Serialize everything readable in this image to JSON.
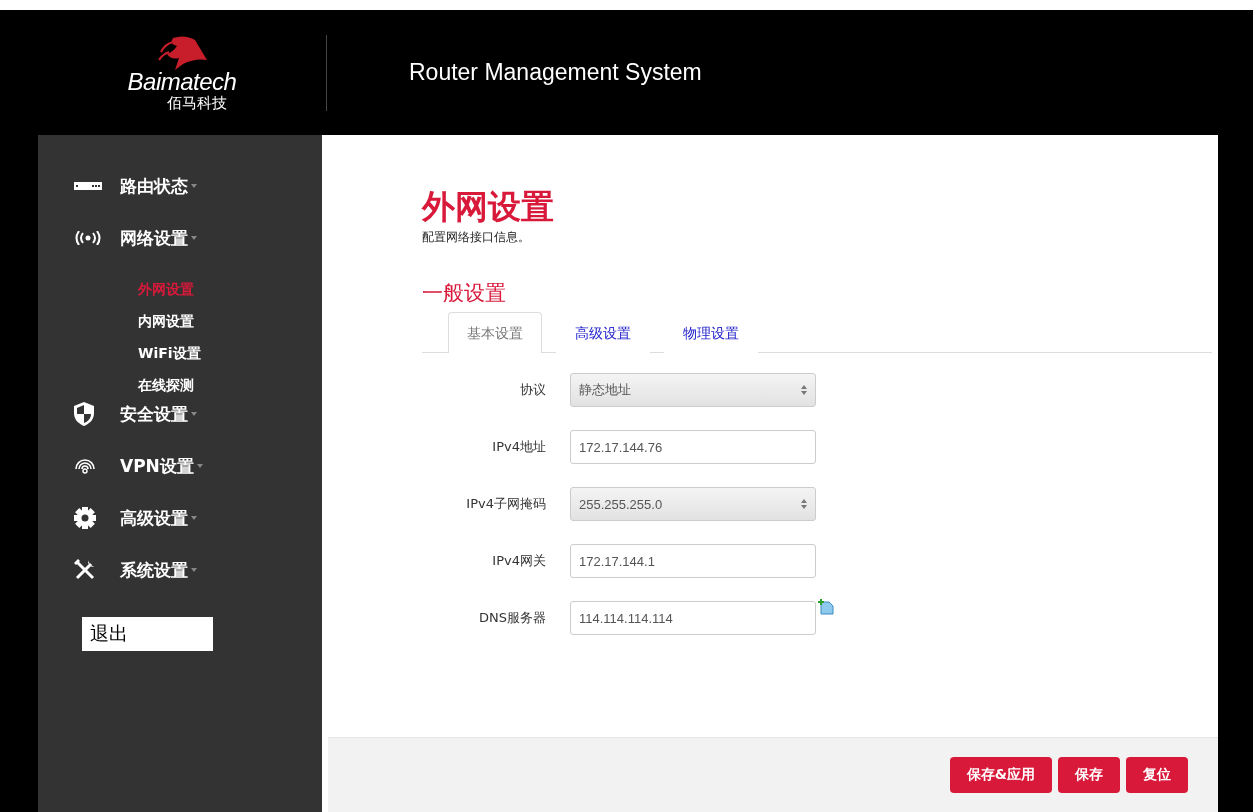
{
  "header": {
    "logo_text": "Baimatech",
    "logo_subtext": "佰马科技",
    "title": "Router Management System"
  },
  "sidebar": {
    "items": [
      {
        "label": "路由状态"
      },
      {
        "label": "网络设置",
        "children": [
          {
            "label": "外网设置",
            "selected": true
          },
          {
            "label": "内网设置",
            "selected": false
          },
          {
            "label": "WiFi设置",
            "selected": false
          },
          {
            "label": "在线探测",
            "selected": false
          }
        ]
      },
      {
        "label": "安全设置"
      },
      {
        "label": "VPN设置"
      },
      {
        "label": "高级设置"
      },
      {
        "label": "系统设置"
      }
    ],
    "logout": "退出"
  },
  "page": {
    "title": "外网设置",
    "description": "配置网络接口信息。",
    "section_title": "一般设置",
    "tabs": [
      {
        "label": "基本设置",
        "selected": true
      },
      {
        "label": "高级设置",
        "selected": false
      },
      {
        "label": "物理设置",
        "selected": false
      }
    ],
    "fields": [
      {
        "label": "协议",
        "kind": "select",
        "value": "静态地址"
      },
      {
        "label": "IPv4地址",
        "kind": "text",
        "value": "172.17.144.76"
      },
      {
        "label": "IPv4子网掩码",
        "kind": "select",
        "value": "255.255.255.0"
      },
      {
        "label": "IPv4网关",
        "kind": "text",
        "value": "172.17.144.1"
      },
      {
        "label": "DNS服务器",
        "kind": "text_add",
        "value": "114.114.114.114"
      }
    ]
  },
  "footer": {
    "buttons": [
      "保存&应用",
      "保存",
      "复位"
    ]
  }
}
